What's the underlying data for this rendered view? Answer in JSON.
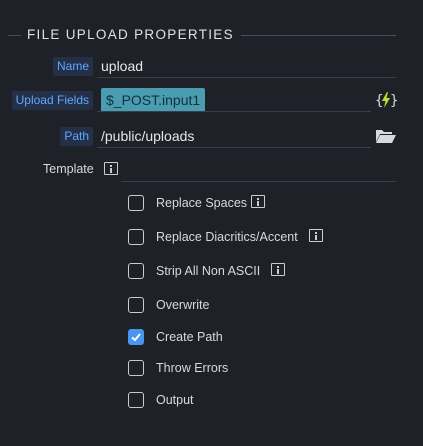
{
  "section": {
    "title": "FILE UPLOAD PROPERTIES"
  },
  "fields": {
    "name": {
      "label": "Name",
      "value": "upload"
    },
    "upload_fields": {
      "label": "Upload Fields",
      "value": "$_POST.input1",
      "action_icon": "lightning-braces-icon"
    },
    "path": {
      "label": "Path",
      "value": "/public/uploads",
      "action_icon": "folder-open-icon"
    },
    "template": {
      "label": "Template",
      "info_icon": "info-icon"
    }
  },
  "options": [
    {
      "label": "Replace Spaces",
      "checked": false,
      "info": true
    },
    {
      "label": "Replace Diacritics/Accent",
      "checked": false,
      "info": true
    },
    {
      "label": "Strip All Non ASCII",
      "checked": false,
      "info": true
    },
    {
      "label": "Overwrite",
      "checked": false,
      "info": false
    },
    {
      "label": "Create Path",
      "checked": true,
      "info": false
    },
    {
      "label": "Throw Errors",
      "checked": false,
      "info": false
    },
    {
      "label": "Output",
      "checked": false,
      "info": false
    }
  ],
  "colors": {
    "background": "#1e2228",
    "label_text": "#5ea7ff",
    "label_bg": "#233047",
    "chip_bg": "#4a9cb1",
    "checkbox_checked": "#4a95ef",
    "lightning": "#b6e034"
  }
}
